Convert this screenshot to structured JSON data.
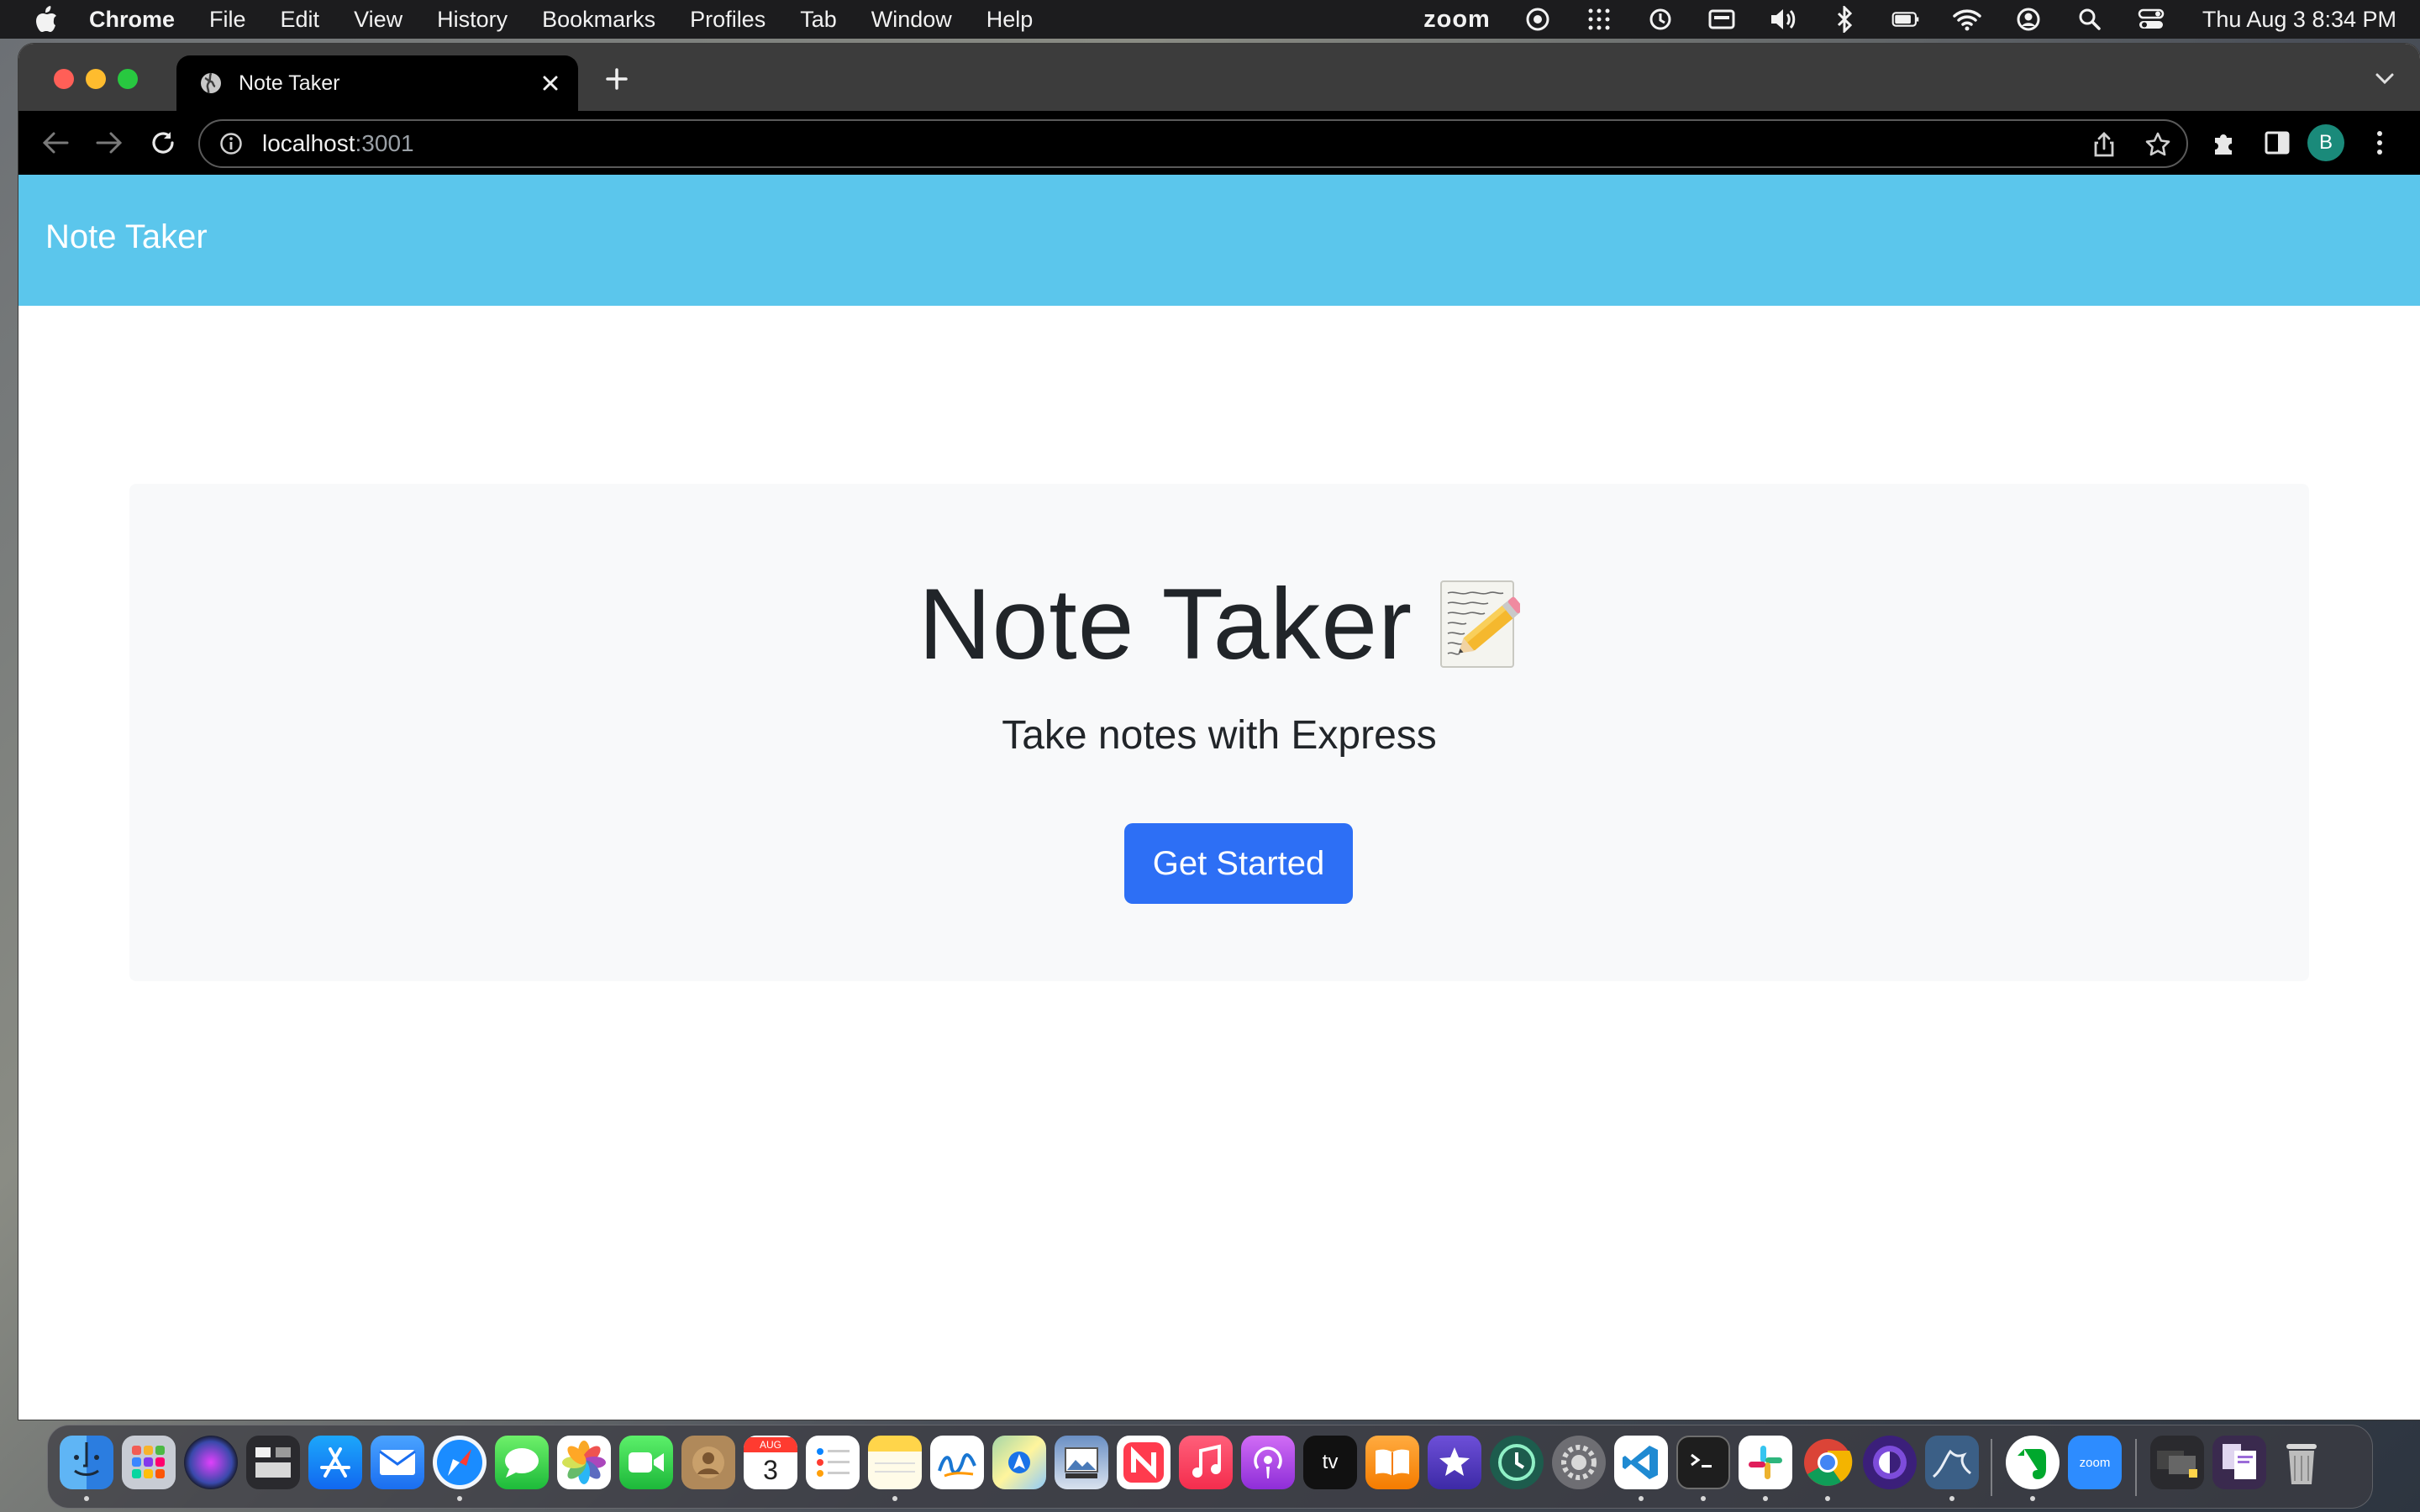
{
  "menubar": {
    "app_name": "Chrome",
    "menus": [
      "File",
      "Edit",
      "View",
      "History",
      "Bookmarks",
      "Profiles",
      "Tab",
      "Window",
      "Help"
    ],
    "status_icons": [
      "zoom-text",
      "screen-record-icon",
      "grid-dots-icon",
      "time-machine-icon",
      "keyboard-input-icon",
      "volume-icon",
      "bluetooth-icon",
      "battery-icon",
      "wifi-icon",
      "user-account-icon",
      "spotlight-search-icon",
      "control-center-icon"
    ],
    "zoom_label": "zoom",
    "clock": "Thu Aug 3  8:34 PM"
  },
  "browser": {
    "tab_title": "Note Taker",
    "url_host": "localhost",
    "url_port": ":3001",
    "profile_initial": "B"
  },
  "page": {
    "brand": "Note Taker",
    "hero_title": "Note Taker",
    "hero_subtitle": "Take notes with Express",
    "cta_label": "Get Started"
  },
  "dock": {
    "apps": [
      "finder",
      "launchpad",
      "siri",
      "mission-control",
      "app-store",
      "mail",
      "safari",
      "messages",
      "photos",
      "facetime",
      "contacts",
      "calendar",
      "reminders",
      "notes",
      "freeform",
      "maps",
      "preview",
      "news",
      "music",
      "podcasts",
      "apple-tv",
      "books",
      "imovie",
      "time-machine",
      "system-settings",
      "vscode",
      "terminal",
      "slack",
      "chrome",
      "tor-browser",
      "mysql-workbench",
      "evernote",
      "zoom",
      "recent-docs",
      "downloads-stack",
      "trash"
    ],
    "calendar_month": "AUG",
    "calendar_day": "3",
    "tv_label": "tv",
    "zoom_label": "zoom"
  },
  "colors": {
    "navbar": "#5bc6ec",
    "button": "#2d6ff5",
    "jumbotron": "#f8f9fa"
  }
}
